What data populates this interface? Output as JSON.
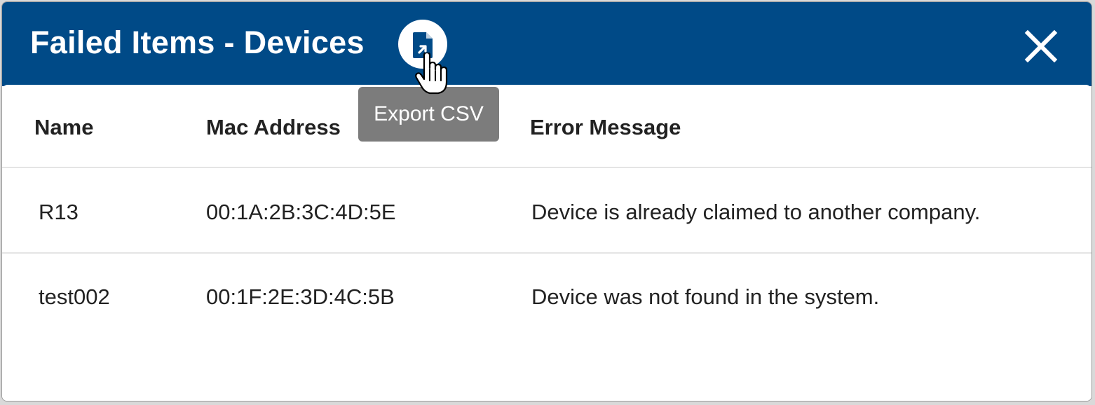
{
  "dialog": {
    "title": "Failed Items - Devices",
    "export_tooltip": "Export CSV",
    "export_icon": "file-export-icon",
    "close_icon": "close-icon"
  },
  "table": {
    "columns": [
      "Name",
      "Mac Address",
      "Error Message"
    ],
    "rows": [
      {
        "name": "R13",
        "mac": "00:1A:2B:3C:4D:5E",
        "error": "Device is already claimed to another company."
      },
      {
        "name": "test002",
        "mac": "00:1F:2E:3D:4C:5B",
        "error": "Device was not found in the system."
      }
    ]
  },
  "colors": {
    "header_bg": "#004a87",
    "tooltip_bg": "#7c7c7c",
    "text": "#222222"
  }
}
